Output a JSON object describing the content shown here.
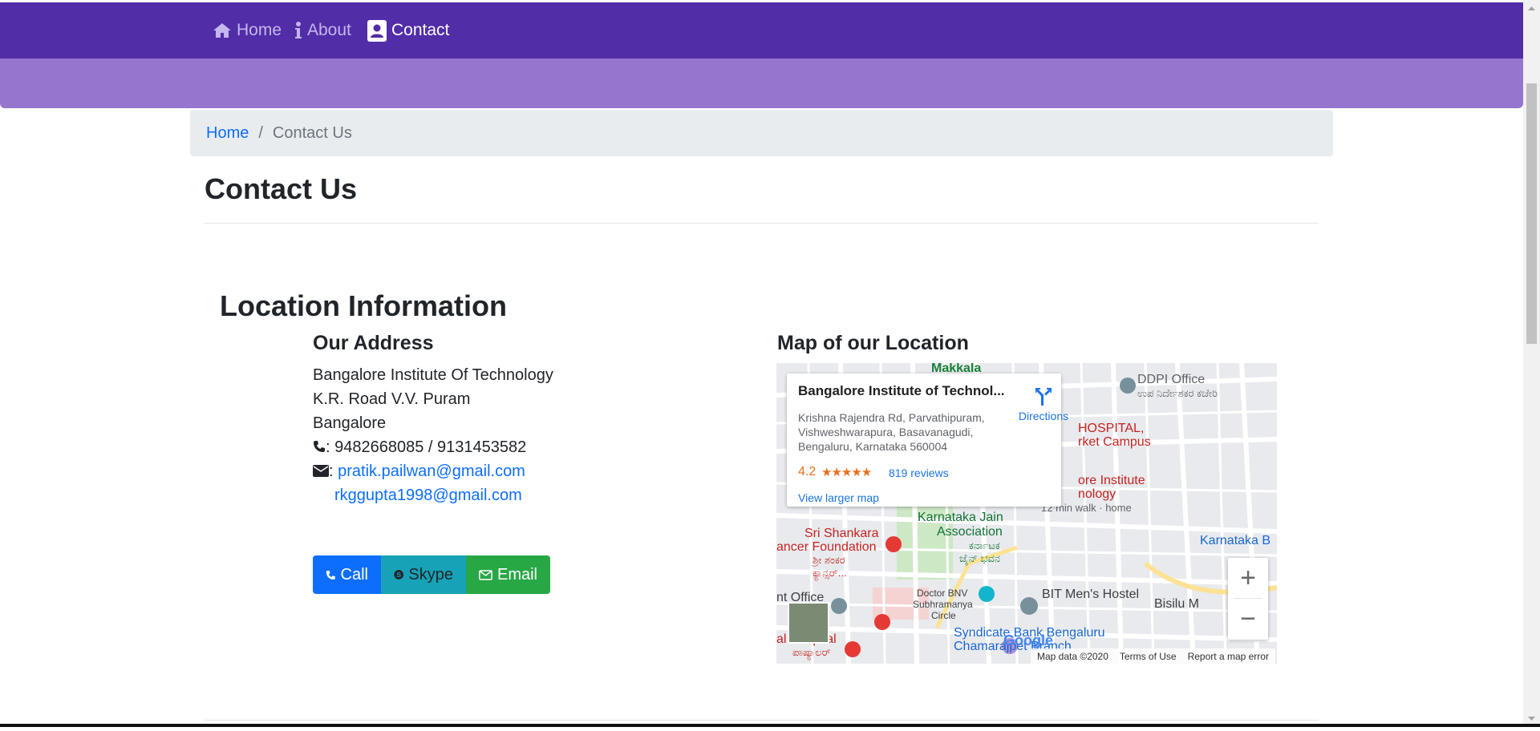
{
  "nav": {
    "items": [
      {
        "label": "Home",
        "icon": "home-icon"
      },
      {
        "label": "About",
        "icon": "info-icon"
      },
      {
        "label": "Contact",
        "icon": "address-card-icon"
      }
    ]
  },
  "breadcrumb": {
    "home": "Home",
    "separator": "/",
    "current": "Contact Us"
  },
  "page": {
    "title": "Contact Us"
  },
  "location": {
    "title": "Location Information",
    "address_heading": "Our Address",
    "address_lines": [
      "Bangalore Institute Of Technology",
      "K.R. Road V.V. Puram",
      "Bangalore"
    ],
    "phone": ": 9482668085 / 9131453582",
    "email_prefix": ":",
    "email_1": "pratik.pailwan@gmail.com",
    "email_2": "rkggupta1998@gmail.com"
  },
  "buttons": {
    "call": "Call",
    "skype": "Skype",
    "email": "Email"
  },
  "map": {
    "heading": "Map of our Location",
    "card": {
      "title": "Bangalore Institute of Technol...",
      "address": "Krishna Rajendra Rd, Parvathipuram, Vishweshwarapura, Basavanagudi, Bengaluru, Karnataka 560004",
      "rating": "4.2",
      "stars": "★★★★★",
      "reviews": "819 reviews",
      "larger": "View larger map",
      "directions": "Directions"
    },
    "labels": {
      "makkala": "Makkala",
      "ddpi": "DDPI Office",
      "ddpi_kn": "ಉಪ ನಿರ್ದೇಶಕರ ಕಚೇರಿ",
      "hospital": "HOSPITAL,",
      "market": "rket Campus",
      "bit": "ore Institute",
      "nology": "nology",
      "walk": "12 min walk · home",
      "jain": "Karnataka Jain",
      "assoc": "Association",
      "jain_kn1": "ಕರ್ನಾಟಕ",
      "jain_kn2": "ಜೈನ್ ಭವನ",
      "sri": "Sri Shankara",
      "cancer": "ancer Foundation",
      "sri_kn": "ಶ್ರೀ ಶಂಕರ",
      "sri_kn2": "ಕ್ಯಾನ್ಸರ್...",
      "karnataka_b": "Karnataka B",
      "bit_hostel": "BIT Men's Hostel",
      "bisilu": "Bisilu M",
      "doctor": "Doctor BNV",
      "subhr": "Subhramanya",
      "circle": "Circle",
      "office": "nt Office",
      "syndicate": "Syndicate Bank Bengaluru",
      "chamarajpet": "Chamarajpet Branch",
      "hospital2": "al Hospital",
      "hospital2_kn": "ಪಾಷ್ಯಾಲರ್",
      "google": "Google"
    },
    "footer": {
      "data": "Map data ©2020",
      "terms": "Terms of Use",
      "report": "Report a map error"
    },
    "zoom_in": "+",
    "zoom_out": "−"
  },
  "colors": {
    "navbar": "#512da8",
    "jumbotron": "#9575cd",
    "link": "#0d6efd",
    "call": "#0d6efd",
    "skype": "#17a2b8",
    "email": "#28a745"
  }
}
